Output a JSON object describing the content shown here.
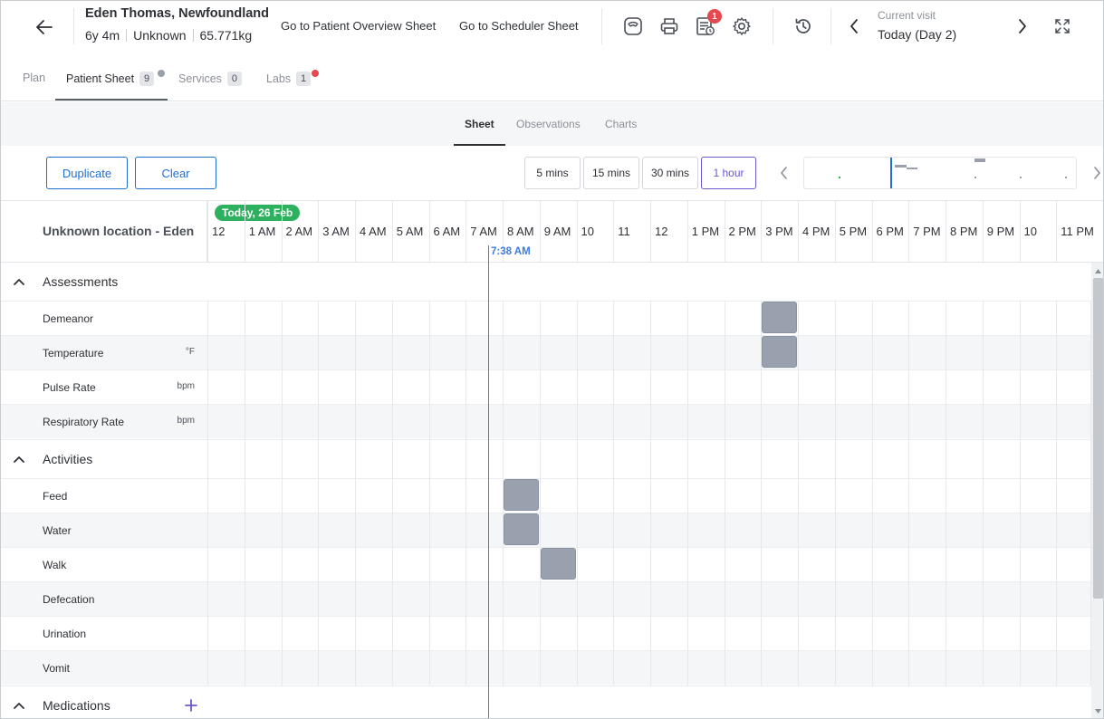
{
  "patient": {
    "name": "Eden Thomas, Newfoundland",
    "age": "6y 4m",
    "sex": "Unknown",
    "weight": "65.771kg"
  },
  "header": {
    "link_overview": "Go to Patient Overview Sheet",
    "link_scheduler": "Go to Scheduler Sheet",
    "notification_count": "1",
    "visit_label": "Current visit",
    "visit_value": "Today (Day 2)"
  },
  "main_tabs": [
    {
      "label": "Plan"
    },
    {
      "label": "Patient Sheet",
      "count": "9"
    },
    {
      "label": "Services",
      "count": "0"
    },
    {
      "label": "Labs",
      "count": "1"
    }
  ],
  "sub_tabs": [
    {
      "label": "Sheet"
    },
    {
      "label": "Observations"
    },
    {
      "label": "Charts"
    }
  ],
  "toolbar": {
    "duplicate": "Duplicate",
    "clear": "Clear",
    "zoom_options": [
      "5 mins",
      "15 mins",
      "30 mins",
      "1 hour"
    ],
    "zoom_selected": "1 hour"
  },
  "grid": {
    "location": "Unknown location - Eden",
    "date_pill": "Today, 26 Feb",
    "now_label": "7:38 AM",
    "hours": [
      "12",
      "1 AM",
      "2 AM",
      "3 AM",
      "4 AM",
      "5 AM",
      "6 AM",
      "7 AM",
      "8 AM",
      "9 AM",
      "10",
      "11",
      "12",
      "1 PM",
      "2 PM",
      "3 PM",
      "4 PM",
      "5 PM",
      "6 PM",
      "7 PM",
      "8 PM",
      "9 PM",
      "10",
      "11 PM"
    ]
  },
  "sections": {
    "assessments": {
      "title": "Assessments",
      "rows": [
        {
          "label": "Demeanor",
          "unit": ""
        },
        {
          "label": "Temperature",
          "unit": "°F"
        },
        {
          "label": "Pulse Rate",
          "unit": "bpm"
        },
        {
          "label": "Respiratory Rate",
          "unit": "bpm"
        }
      ]
    },
    "activities": {
      "title": "Activities",
      "rows": [
        {
          "label": "Feed"
        },
        {
          "label": "Water"
        },
        {
          "label": "Walk"
        },
        {
          "label": "Defecation"
        },
        {
          "label": "Urination"
        },
        {
          "label": "Vomit"
        }
      ]
    },
    "medications": {
      "title": "Medications"
    }
  },
  "scheduled_tasks": [
    {
      "task": "Demeanor",
      "hour": "3 PM"
    },
    {
      "task": "Temperature",
      "hour": "3 PM"
    },
    {
      "task": "Feed",
      "hour": "8 AM"
    },
    {
      "task": "Water",
      "hour": "8 AM"
    },
    {
      "task": "Walk",
      "hour": "9 AM"
    }
  ],
  "colors": {
    "accent_blue": "#1f6fd1",
    "accent_purple": "#6e56cf",
    "today_green": "#2eb15f",
    "now_line": "#3b7ddd",
    "task_block": "#9aa1ae",
    "badge_red": "#e5484d"
  }
}
